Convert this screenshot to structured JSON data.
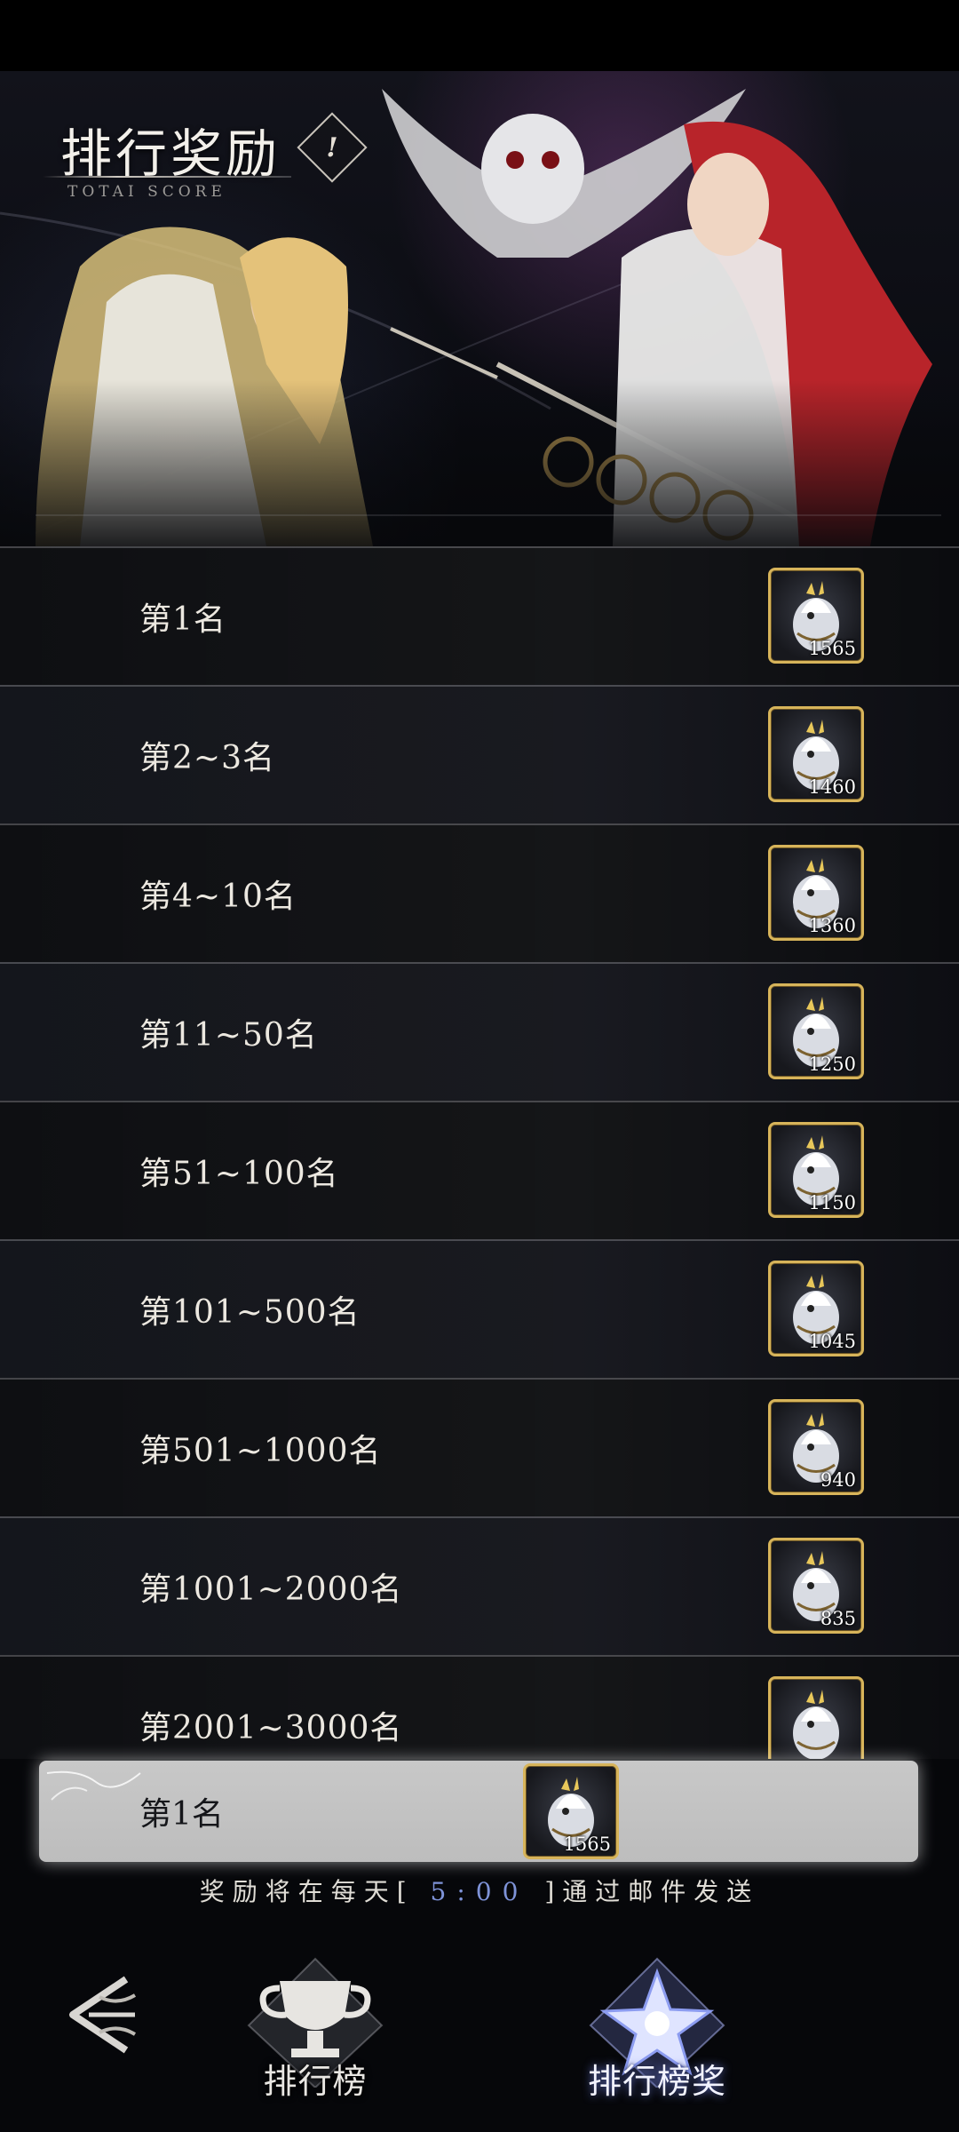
{
  "header": {
    "title": "排行奖励",
    "subtitle": "TOTAI SCORE",
    "info_icon": "info-icon"
  },
  "reward_rows": [
    {
      "rank": "第1名",
      "count": "1565"
    },
    {
      "rank": "第2~3名",
      "count": "1460"
    },
    {
      "rank": "第4~10名",
      "count": "1360"
    },
    {
      "rank": "第11~50名",
      "count": "1250"
    },
    {
      "rank": "第51~100名",
      "count": "1150"
    },
    {
      "rank": "第101~500名",
      "count": "1045"
    },
    {
      "rank": "第501~1000名",
      "count": "940"
    },
    {
      "rank": "第1001~2000名",
      "count": "835"
    },
    {
      "rank": "第2001~3000名",
      "count": ""
    }
  ],
  "my_rank": {
    "rank": "第1名",
    "count": "1565"
  },
  "notice": {
    "prefix": "奖励将在每天[",
    "time": "5:00",
    "suffix": "]通过邮件发送"
  },
  "nav": {
    "back_icon": "back-arrow-icon",
    "tabs": [
      {
        "label": "排行榜",
        "icon": "trophy-icon",
        "active": false
      },
      {
        "label": "排行榜奖",
        "icon": "star-icon",
        "active": true
      }
    ]
  },
  "colors": {
    "icon_border": "#d7b45a",
    "time_highlight": "#7e93d8",
    "accent": "#6a7ad8"
  }
}
